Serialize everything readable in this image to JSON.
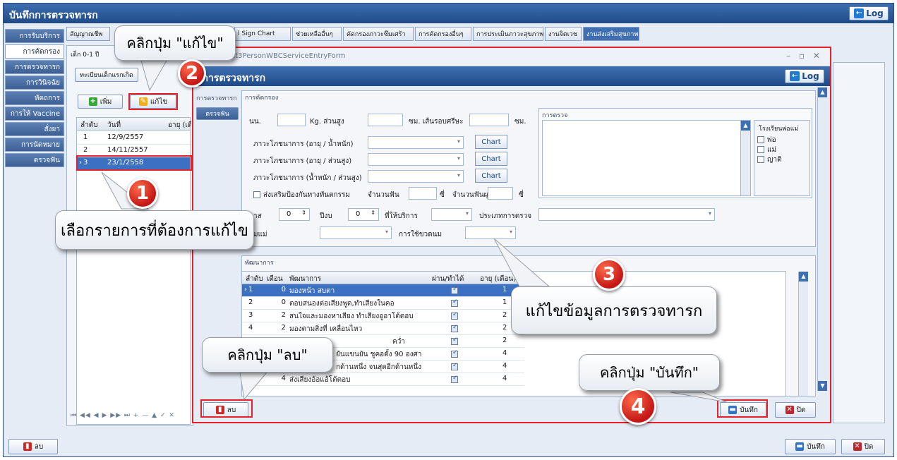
{
  "app": {
    "title": "บันทึกการตรวจทารก",
    "log_label": "Log",
    "left_nav": [
      {
        "label": "การรับบริการ"
      },
      {
        "label": "การคัดกรอง"
      },
      {
        "label": "การตรวจทารก"
      },
      {
        "label": "การวินิจฉัย"
      },
      {
        "label": "หัตถการ"
      },
      {
        "label": "การให้ Vaccine"
      },
      {
        "label": "สั่งยา"
      },
      {
        "label": "การนัดหมาย"
      },
      {
        "label": "ตรวจฟัน"
      }
    ],
    "top_tabs": [
      {
        "label": "สัญญาณชีพ"
      },
      {
        "label": "l Sign Chart"
      },
      {
        "label": "ช่วยเหลืออื่นๆ"
      },
      {
        "label": "คัดกรองภาวะซึมเศร้า"
      },
      {
        "label": "การคัดกรองอื่นๆ"
      },
      {
        "label": "การประเมินภาวะสุขภาพ"
      },
      {
        "label": "งานจิตเวช"
      },
      {
        "label": "งานส่งเสริมสุขภาพ"
      }
    ],
    "sub_tab": "เด็ก 0-1 ปี",
    "register_tab": "ทะเบียนเด็กแรกเกิด",
    "add_label": "เพิ่ม",
    "edit_label": "แก้ไข",
    "visit_grid": {
      "headers": [
        "ลำดับ",
        "วันที่",
        "อายุ (เดือ"
      ],
      "rows": [
        {
          "no": "1",
          "date": "12/9/2557"
        },
        {
          "no": "2",
          "date": "14/11/2557"
        },
        {
          "no": "3",
          "date": "23/1/2558"
        }
      ]
    },
    "nav_controls": "⏮ ◀◀ ◀ ▶ ▶▶ ⏭ + — ▲ ✓ ✕",
    "delete_label": "ลบ",
    "save_label": "บันทึก",
    "close_label": "ปิด"
  },
  "dialog": {
    "window_title": "CUAcount3PersonWBCServiceEntryForm",
    "window_controls": "–  ▫  ✕",
    "header_title": "กการตรวจทารก",
    "side_section": "การตรวจทารก",
    "side_item": "ตรวจฟัน",
    "screening": {
      "group_title": "การคัดกรอง",
      "weight_label": "นน.",
      "height_label": "Kg. ส่วนสูง",
      "head_label": "ซม. เส้นรอบศรีษะ",
      "head_unit": "ซม.",
      "nutrition_rows": [
        {
          "label": "ภาวะโภชนาการ (อายุ / น้ำหนัก)",
          "button": "Chart"
        },
        {
          "label": "ภาวะโภชนาการ (อายุ / ส่วนสูง)",
          "button": "Chart"
        },
        {
          "label": "ภาวะโภชนาการ (น้ำหนัก / ส่วนสูง)",
          "button": "Chart"
        }
      ],
      "fluoride_label": "ส่งเสริมป้องกันทางทันตกรรม",
      "teeth_label": "จำนวนฟัน",
      "teeth_unit": "ซี่",
      "decay_label": "จำนวนฟันผุ",
      "decay_unit": "ซี่",
      "month_label": "าส",
      "month_value": "0",
      "year_label": "ปีงบ",
      "year_value": "0",
      "place_label": "ที่ให้บริการ",
      "exam_type_label": "ประเภทการตรวจ",
      "mother_label": "มแม่",
      "bottle_label": "การใช้ขวดนม"
    },
    "exam": {
      "group_title": "การตรวจ",
      "parent_school_title": "โรงเรียนพ่อแม่",
      "options": [
        "พ่อ",
        "แม่",
        "ญาติ"
      ]
    },
    "development": {
      "group_title": "พัฒนาการ",
      "headers": [
        "ลำดับ",
        "เดือน",
        "พัฒนาการ",
        "ผ่าน/ทำได้",
        "อายุ (เดือน)"
      ],
      "rows": [
        {
          "no": "1",
          "month": "0",
          "text": "มองหน้า สบตา",
          "passed": true,
          "age": "1"
        },
        {
          "no": "2",
          "month": "0",
          "text": "ตอบสนองต่อเสียงพูด,ทำเสียงในคอ",
          "passed": true,
          "age": "1"
        },
        {
          "no": "3",
          "month": "2",
          "text": "สนใจและมองหาเสียง ทำเสียงอูอาโต้ตอบ",
          "passed": true,
          "age": "2"
        },
        {
          "no": "4",
          "month": "2",
          "text": "มองตามสิ่งที่ เคลื่อนไหว",
          "passed": true,
          "age": "2"
        },
        {
          "no": "5",
          "month": "",
          "text": "คว่ำ",
          "passed": true,
          "age": "2"
        },
        {
          "no": "6",
          "month": "",
          "text": "ยันแขนยัน ชูคอตั้ง 90 องศา",
          "passed": true,
          "age": "4"
        },
        {
          "no": "7",
          "month": "",
          "text": "กด้านหนึ่ง จนสุดอีกด้านหนึ่ง",
          "passed": true,
          "age": "4"
        },
        {
          "no": "8",
          "month": "4",
          "text": "ส่งเสียงอ้อแอ้โต้ตอบ",
          "passed": true,
          "age": "4"
        }
      ]
    },
    "delete_label": "ลบ",
    "save_label": "บันทึก",
    "close_label": "ปิด"
  },
  "annotations": {
    "step1_text": "เลือกรายการที่ต้องการแก้ไข",
    "step2_text": "คลิกปุ่ม \"แก้ไข\"",
    "step3_text": "แก้ไขข้อมูลการตรวจทารก",
    "step4_text": "คลิกปุ่ม \"บันทึก\"",
    "delete_text": "คลิกปุ่ม \"ลบ\"",
    "badges": [
      "1",
      "2",
      "3",
      "4"
    ]
  },
  "colors": {
    "accent_blue": "#3f6fb0",
    "highlight_red": "#e3232a",
    "selected_row": "#3c70c2"
  }
}
